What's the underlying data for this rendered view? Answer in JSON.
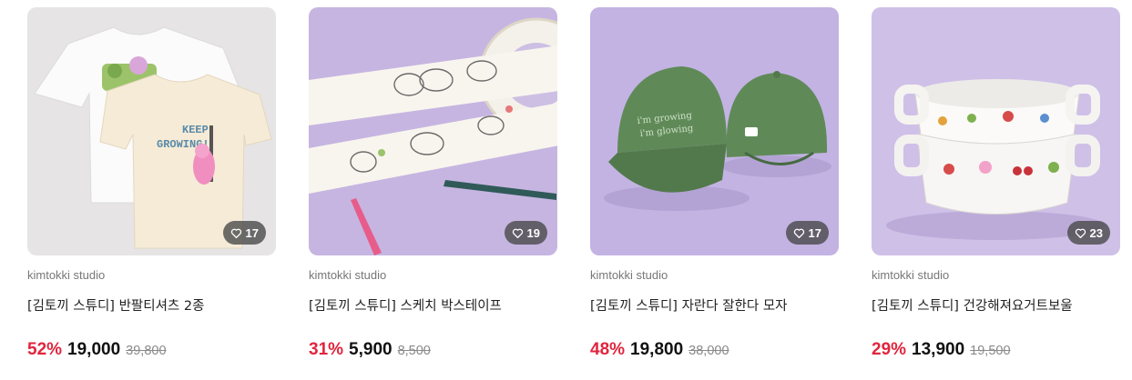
{
  "products": [
    {
      "image_alt": "반팔티셔츠",
      "likes": "17",
      "brand": "kimtokki studio",
      "title": "[김토끼 스튜디] 반팔티셔츠 2종",
      "discount": "52%",
      "price": "19,000",
      "original_price": "39,800",
      "bg": "#e5e3e4"
    },
    {
      "image_alt": "스케치 박스테이프",
      "likes": "19",
      "brand": "kimtokki studio",
      "title": "[김토끼 스튜디] 스케치 박스테이프",
      "discount": "31%",
      "price": "5,900",
      "original_price": "8,500",
      "bg": "#c7b6e2"
    },
    {
      "image_alt": "자란다 잘한다 모자",
      "likes": "17",
      "brand": "kimtokki studio",
      "title": "[김토끼 스튜디] 자란다 잘한다 모자",
      "discount": "48%",
      "price": "19,800",
      "original_price": "38,000",
      "bg": "#c3b3e3"
    },
    {
      "image_alt": "건강해져요거트보울",
      "likes": "23",
      "brand": "kimtokki studio",
      "title": "[김토끼 스튜디] 건강해져요거트보울",
      "discount": "29%",
      "price": "13,900",
      "original_price": "19,500",
      "bg": "#cfc0e8"
    }
  ],
  "colors": {
    "discount": "#e0253d",
    "badge": "#464646"
  },
  "icons": {
    "like": "heart-outline-icon"
  }
}
